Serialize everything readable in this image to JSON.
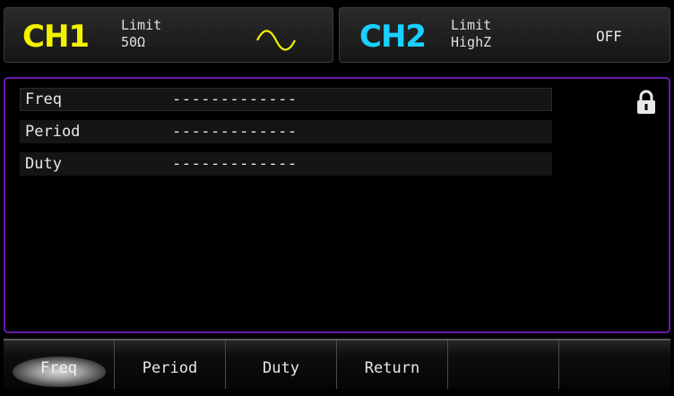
{
  "header": {
    "ch1": {
      "name": "CH1",
      "mode_label": "Limit",
      "load": "50Ω",
      "waveform_icon": "sine-wave-icon",
      "color": "#f2f200"
    },
    "ch2": {
      "name": "CH2",
      "mode_label": "Limit",
      "load": "HighZ",
      "state": "OFF",
      "color": "#19d0ff"
    }
  },
  "params": [
    {
      "label": "Freq",
      "value": "-------------"
    },
    {
      "label": "Period",
      "value": "-------------"
    },
    {
      "label": "Duty",
      "value": "-------------"
    }
  ],
  "lock_icon": "lock-icon",
  "softkeys": [
    {
      "label": "Freq",
      "selected": true
    },
    {
      "label": "Period"
    },
    {
      "label": "Duty"
    },
    {
      "label": "Return"
    },
    {
      "label": ""
    },
    {
      "label": ""
    }
  ],
  "colors": {
    "panel_border": "#6a1aa8"
  }
}
